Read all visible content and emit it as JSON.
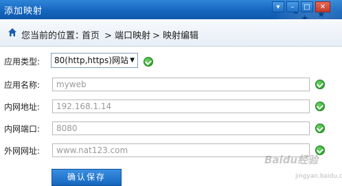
{
  "window": {
    "title": "添加映射"
  },
  "breadcrumb": {
    "prefix": "您当前的位置：",
    "items": [
      "首页",
      "> 端口映射",
      "> 映射编辑"
    ]
  },
  "form": {
    "app_type": {
      "label": "应用类型:",
      "value": "80(http,https)网站"
    },
    "app_name": {
      "label": "应用名称:",
      "placeholder": "myweb"
    },
    "lan_addr": {
      "label": "内网地址:",
      "placeholder": "192.168.1.14"
    },
    "lan_port": {
      "label": "内网端口:",
      "placeholder": "8080"
    },
    "wan_addr": {
      "label": "外网网址:",
      "placeholder": "www.nat123.com"
    }
  },
  "save_button": {
    "label": "确认保存"
  },
  "watermark": {
    "text": "Baidu经验",
    "subtext": "jingyan.baidu.com"
  },
  "colors": {
    "title_bar": "#1566bf",
    "button": "#1566bf",
    "check": "#1e9a1e"
  }
}
